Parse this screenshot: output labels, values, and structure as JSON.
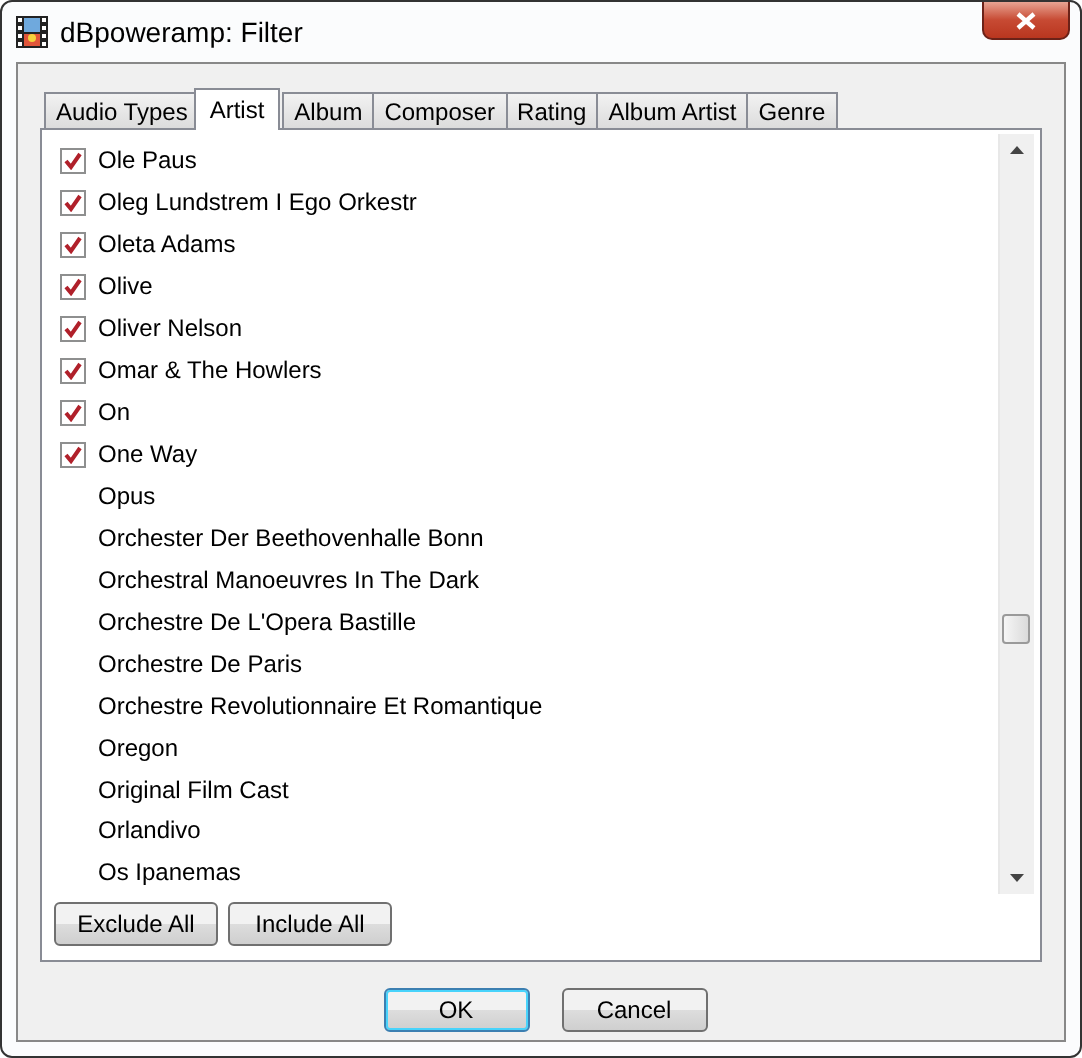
{
  "window": {
    "title": "dBpoweramp: Filter"
  },
  "tabs": [
    {
      "label": "Audio Types",
      "selected": false
    },
    {
      "label": "Artist",
      "selected": true
    },
    {
      "label": "Album",
      "selected": false
    },
    {
      "label": "Composer",
      "selected": false
    },
    {
      "label": "Rating",
      "selected": false
    },
    {
      "label": "Album Artist",
      "selected": false
    },
    {
      "label": "Genre",
      "selected": false
    }
  ],
  "list": [
    {
      "label": "Ole Paus",
      "checked": true
    },
    {
      "label": "Oleg Lundstrem I Ego Orkestr",
      "checked": true
    },
    {
      "label": "Oleta Adams",
      "checked": true
    },
    {
      "label": "Olive",
      "checked": true
    },
    {
      "label": "Oliver Nelson",
      "checked": true
    },
    {
      "label": "Omar & The Howlers",
      "checked": true
    },
    {
      "label": "On",
      "checked": true
    },
    {
      "label": "One Way",
      "checked": true
    },
    {
      "label": "Opus",
      "checked": false
    },
    {
      "label": "Orchester Der Beethovenhalle Bonn",
      "checked": false
    },
    {
      "label": "Orchestral Manoeuvres In The Dark",
      "checked": false
    },
    {
      "label": "Orchestre De L'Opera Bastille",
      "checked": false
    },
    {
      "label": "Orchestre De Paris",
      "checked": false
    },
    {
      "label": "Orchestre Revolutionnaire Et Romantique",
      "checked": false
    },
    {
      "label": "Oregon",
      "checked": false
    },
    {
      "label": "Original Film Cast",
      "checked": false
    },
    {
      "label": "Orlandivo",
      "checked": false
    },
    {
      "label": "Os Ipanemas",
      "checked": false
    }
  ],
  "list_buttons": [
    "Exclude All",
    "Include All"
  ],
  "dialog_buttons": [
    {
      "label": "OK",
      "default": true
    },
    {
      "label": "Cancel",
      "default": false
    }
  ]
}
